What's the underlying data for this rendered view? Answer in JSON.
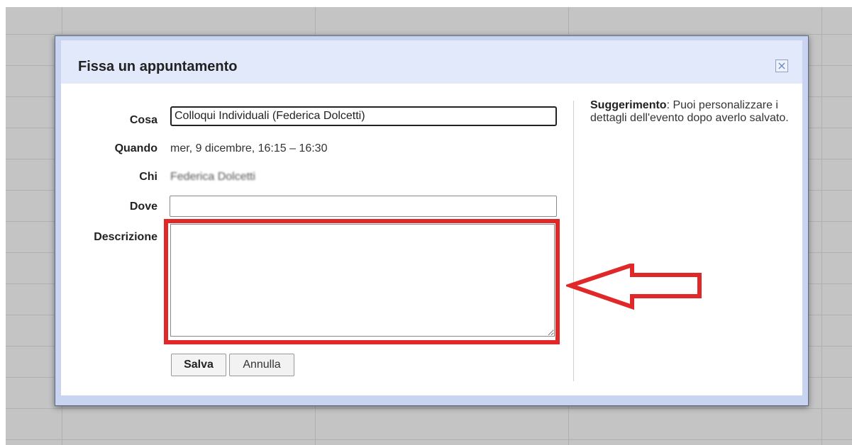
{
  "dialog": {
    "title": "Fissa un appuntamento",
    "close_icon": "close-icon"
  },
  "form": {
    "cosa_label": "Cosa",
    "cosa_value": "Colloqui Individuali (Federica Dolcetti)",
    "quando_label": "Quando",
    "quando_value": "mer, 9 dicembre, 16:15 – 16:30",
    "chi_label": "Chi",
    "chi_value": "Federica Dolcetti",
    "dove_label": "Dove",
    "dove_value": "",
    "descrizione_label": "Descrizione",
    "descrizione_value": ""
  },
  "buttons": {
    "save_label": "Salva",
    "cancel_label": "Annulla"
  },
  "tip": {
    "bold": "Suggerimento",
    "text": ": Puoi personalizzare i dettagli dell'evento dopo averlo salvato."
  },
  "annotation": {
    "highlight_color": "#e02828",
    "arrow_color": "#e02828"
  }
}
